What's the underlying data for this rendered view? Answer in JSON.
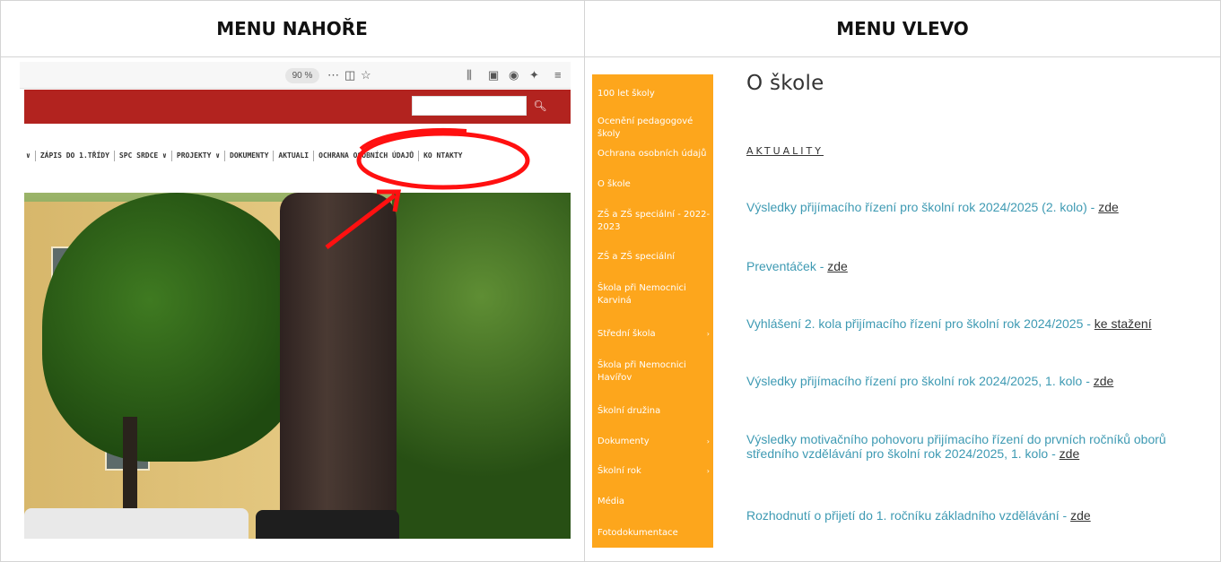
{
  "header": {
    "left": "MENU NAHOŘE",
    "right": "MENU VLEVO"
  },
  "left_shot": {
    "zoom": "90 %",
    "nav_items": [
      "∨",
      "ZÁPIS DO 1.TŘÍDY",
      "SPC SRDCE ∨",
      "PROJEKTY ∨",
      "DOKUMENTY",
      "AKTUALI",
      "OCHRANA OSOBNÍCH ÚDAJŮ",
      "KO NTAKTY"
    ],
    "search_icon": "search-icon"
  },
  "orange_menu": {
    "items": [
      {
        "label": "100 let školy",
        "arrow": ""
      },
      {
        "label": "Ocenění pedagogové školy",
        "arrow": ""
      },
      {
        "label": "Ochrana osobních údajů",
        "arrow": ""
      },
      {
        "label": "O škole",
        "arrow": ""
      },
      {
        "label": "ZŠ a ZŠ speciální - 2022-2023",
        "arrow": ""
      },
      {
        "label": "ZŠ a ZŠ speciální",
        "arrow": ""
      },
      {
        "label": "Škola při Nemocnici Karviná",
        "arrow": ""
      },
      {
        "label": "Střední škola",
        "arrow": "›"
      },
      {
        "label": "Škola při Nemocnici Havířov",
        "arrow": ""
      },
      {
        "label": "Školní družina",
        "arrow": ""
      },
      {
        "label": "Dokumenty",
        "arrow": "›"
      },
      {
        "label": "Školní rok",
        "arrow": "›"
      },
      {
        "label": "Média",
        "arrow": ""
      },
      {
        "label": "Fotodokumentace",
        "arrow": ""
      }
    ]
  },
  "content": {
    "title": "O škole",
    "section": "AKTUALITY",
    "items": [
      {
        "text": "Výsledky přijímacího řízení pro školní rok 2024/2025 (2. kolo) - ",
        "link": "zde"
      },
      {
        "text": "Preventáček - ",
        "link": "zde"
      },
      {
        "text": "Vyhlášení 2. kola přijímacího řízení pro školní rok 2024/2025 - ",
        "link": "ke stažení"
      },
      {
        "text": "Výsledky přijímacího řízení pro školní rok 2024/2025, 1. kolo - ",
        "link": "zde"
      },
      {
        "text": "Výsledky motivačního pohovoru přijímacího řízení do prvních ročníků oborů středního vzdělávání pro školní rok 2024/2025, 1. kolo - ",
        "link": "zde"
      },
      {
        "text": "Rozhodnutí o přijetí do 1. ročníku základního vzdělávání - ",
        "link": "zde"
      }
    ]
  },
  "colors": {
    "orange": "#fda61c",
    "red_bar": "#b2231f",
    "link_blue": "#3e9ab3",
    "scribble_red": "#ff1010"
  }
}
